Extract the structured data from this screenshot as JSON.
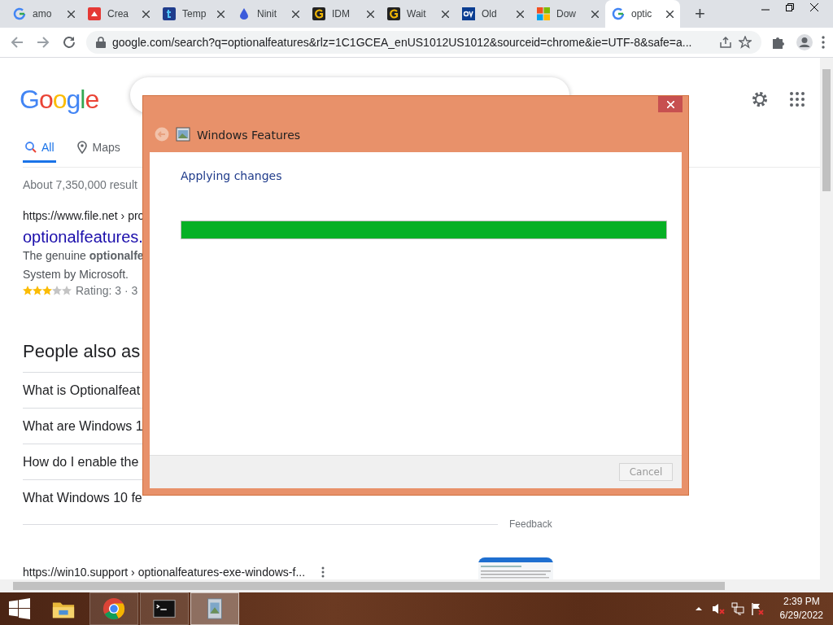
{
  "browser": {
    "tabs": [
      {
        "label": "amo",
        "kind": "google",
        "selected": false
      },
      {
        "label": "Crea",
        "kind": "red",
        "selected": false
      },
      {
        "label": "Temp",
        "kind": "blue-t",
        "selected": false
      },
      {
        "label": "Ninit",
        "kind": "drop",
        "selected": false
      },
      {
        "label": "IDM",
        "kind": "ring",
        "selected": false
      },
      {
        "label": "Wait",
        "kind": "ring",
        "selected": false
      },
      {
        "label": "Old",
        "kind": "navy",
        "selected": false
      },
      {
        "label": "Dow",
        "kind": "windows",
        "selected": false
      },
      {
        "label": "optic",
        "kind": "google",
        "selected": true
      }
    ],
    "new_tab": "+",
    "address": "google.com/search?q=optionalfeatures&rlz=1C1GCEA_enUS1012US1012&sourceid=chrome&ie=UTF-8&safe=a..."
  },
  "google": {
    "logo": "Google",
    "nav": [
      {
        "label": "All",
        "kind": "search",
        "selected": true
      },
      {
        "label": "Maps",
        "kind": "pin",
        "selected": false
      }
    ],
    "result_count": "About 7,350,000 result",
    "result1": {
      "url": "https://www.file.net › pro",
      "title": "optionalfeatures.",
      "snippet": [
        "The genuine **optionalfe**",
        "System by Microsoft."
      ],
      "stars": 3,
      "rating": "Rating: 3 · 3"
    },
    "people_also_ask": {
      "heading": "People also as",
      "questions": [
        "What is Optionalfeat",
        "What are Windows 1",
        "How do I enable the",
        "What Windows 10 fe"
      ]
    },
    "feedback": "Feedback",
    "result2": {
      "url": "https://win10.support › optionalfeatures-exe-windows-f..."
    }
  },
  "dialog": {
    "title": "Windows Features",
    "status": "Applying changes",
    "progress": {
      "level": 1
    },
    "cancel": {
      "label": "Cancel",
      "disabled": true
    }
  },
  "taskbar": {
    "apps": [
      {
        "kind": "folder",
        "selected": false
      },
      {
        "kind": "chrome",
        "selected": false
      },
      {
        "kind": "console",
        "selected": false
      },
      {
        "kind": "features",
        "selected": true
      }
    ],
    "time": "2:39 PM",
    "date": "6/29/2022"
  }
}
